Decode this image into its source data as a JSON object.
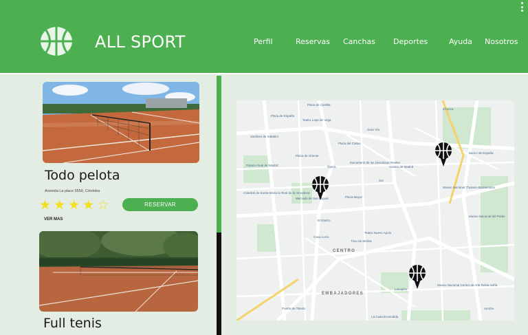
{
  "header": {
    "title": "ALL SPORT",
    "nav": [
      "Perfil",
      "Reservas",
      "Canchas",
      "Deportes",
      "Ayuda",
      "Nosotros"
    ]
  },
  "cards": [
    {
      "title": "Todo pelota",
      "address": "Avenida La place 5550, Córdoba",
      "rating": 4.5,
      "reserve_label": "RESERVAR",
      "more_label": "VER MAS"
    },
    {
      "title": "Full tenis"
    }
  ],
  "map": {
    "labels": [
      "Plaza de Castilla",
      "Teatro Lope de Vega",
      "Plaza del Callao",
      "Jardines de Sabatini",
      "Plaza de Oriente",
      "Ópera",
      "Monasterio de las Descalzas Reales",
      "Casino de Madrid",
      "Museo Nacional Thyssen-Bornemisza",
      "Banco de España",
      "Palacio Real de Madrid",
      "Mercado de San Miguel",
      "Plaza Mayor",
      "Sol",
      "Museo Nacional del Prado",
      "Catedral de Santa María la Real de la Almudena",
      "El Rastro",
      "Teatro Nuevo Apolo",
      "Tirso de Molina",
      "CENTRO",
      "EMBAJADORES",
      "Lavapiés",
      "Casa Lucio",
      "Museo Nacional Centro de Arte Reina Sofía",
      "Puerta de Toledo",
      "La Casa Encendida",
      "Plaza de España",
      "Gran Vía",
      "Chueca",
      "Atocha"
    ]
  },
  "colors": {
    "primary": "#4caf50",
    "background": "#e3ede3",
    "star": "#f5de1d"
  }
}
